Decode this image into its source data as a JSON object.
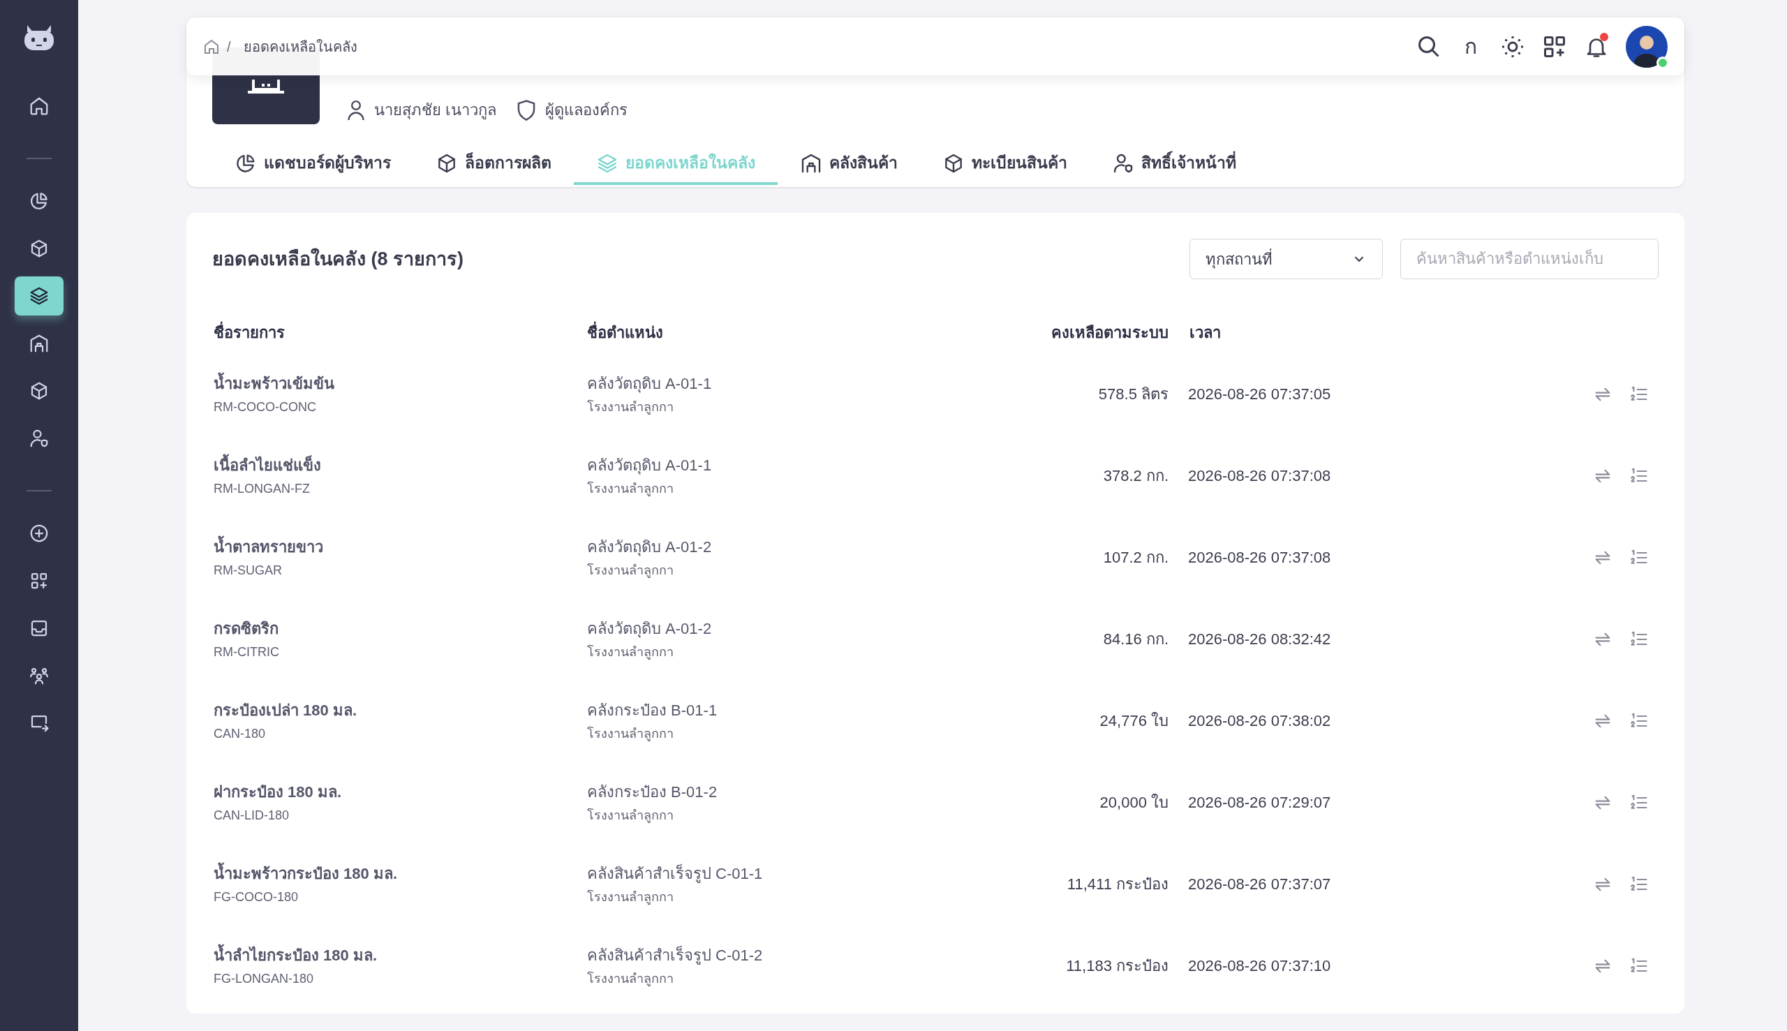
{
  "sidebar": {
    "groups": [
      {
        "items": [
          {
            "selected": false
          }
        ]
      },
      {
        "items": [
          {
            "selected": false
          },
          {
            "selected": false
          },
          {
            "selected": true
          },
          {
            "selected": false
          },
          {
            "selected": false
          },
          {
            "selected": false
          }
        ]
      },
      {
        "items": [
          {
            "selected": false
          },
          {
            "selected": false
          },
          {
            "selected": false
          },
          {
            "selected": false
          },
          {
            "selected": false
          }
        ]
      }
    ]
  },
  "breadcrumb": {
    "separator": "/",
    "items": [
      "ยอดคงเหลือในคลัง"
    ]
  },
  "topbar": {
    "language": "ก",
    "notifications": true,
    "online": true
  },
  "header": {
    "user": "นายสุภชัย เนาวกูล",
    "role": "ผู้ดูแลองค์กร"
  },
  "tabs": [
    {
      "label": "แดชบอร์ดผู้บริหาร",
      "selected": false
    },
    {
      "label": "ล็อตการผลิต",
      "selected": false
    },
    {
      "label": "ยอดคงเหลือในคลัง",
      "selected": true
    },
    {
      "label": "คลังสินค้า",
      "selected": false
    },
    {
      "label": "ทะเบียนสินค้า",
      "selected": false
    },
    {
      "label": "สิทธิ์เจ้าหน้าที่",
      "selected": false
    }
  ],
  "panel": {
    "title": "ยอดคงเหลือในคลัง (8 รายการ)",
    "location_filter": "ทุกสถานที่",
    "search": {
      "placeholder": "ค้นหาสินค้าหรือตำแหน่งเก็บ"
    }
  },
  "table": {
    "columns": [
      "ชื่อรายการ",
      "ชื่อตำแหน่ง",
      "คงเหลือตามระบบ",
      "เวลา"
    ],
    "rows": [
      {
        "name": "น้ำมะพร้าวเข้มข้น",
        "code": "RM-COCO-CONC",
        "location": "คลังวัตถุดิบ A-01-1",
        "site": "โรงงานลำลูกกา",
        "quantity": "578.5 ลิตร",
        "time": "2026-08-26 07:37:05"
      },
      {
        "name": "เนื้อลำไยแช่แข็ง",
        "code": "RM-LONGAN-FZ",
        "location": "คลังวัตถุดิบ A-01-1",
        "site": "โรงงานลำลูกกา",
        "quantity": "378.2 กก.",
        "time": "2026-08-26 07:37:08"
      },
      {
        "name": "น้ำตาลทรายขาว",
        "code": "RM-SUGAR",
        "location": "คลังวัตถุดิบ A-01-2",
        "site": "โรงงานลำลูกกา",
        "quantity": "107.2 กก.",
        "time": "2026-08-26 07:37:08"
      },
      {
        "name": "กรดซิตริก",
        "code": "RM-CITRIC",
        "location": "คลังวัตถุดิบ A-01-2",
        "site": "โรงงานลำลูกกา",
        "quantity": "84.16 กก.",
        "time": "2026-08-26 08:32:42"
      },
      {
        "name": "กระป๋องเปล่า 180 มล.",
        "code": "CAN-180",
        "location": "คลังกระป๋อง B-01-1",
        "site": "โรงงานลำลูกกา",
        "quantity": "24,776 ใบ",
        "time": "2026-08-26 07:38:02"
      },
      {
        "name": "ฝากระป๋อง 180 มล.",
        "code": "CAN-LID-180",
        "location": "คลังกระป๋อง B-01-2",
        "site": "โรงงานลำลูกกา",
        "quantity": "20,000 ใบ",
        "time": "2026-08-26 07:29:07"
      },
      {
        "name": "น้ำมะพร้าวกระป๋อง 180 มล.",
        "code": "FG-COCO-180",
        "location": "คลังสินค้าสำเร็จรูป C-01-1",
        "site": "โรงงานลำลูกกา",
        "quantity": "11,411 กระป๋อง",
        "time": "2026-08-26 07:37:07"
      },
      {
        "name": "น้ำลำไยกระป๋อง 180 มล.",
        "code": "FG-LONGAN-180",
        "location": "คลังสินค้าสำเร็จรูป C-01-2",
        "site": "โรงงานลำลูกกา",
        "quantity": "11,183 กระป๋อง",
        "time": "2026-08-26 07:37:10"
      }
    ]
  }
}
